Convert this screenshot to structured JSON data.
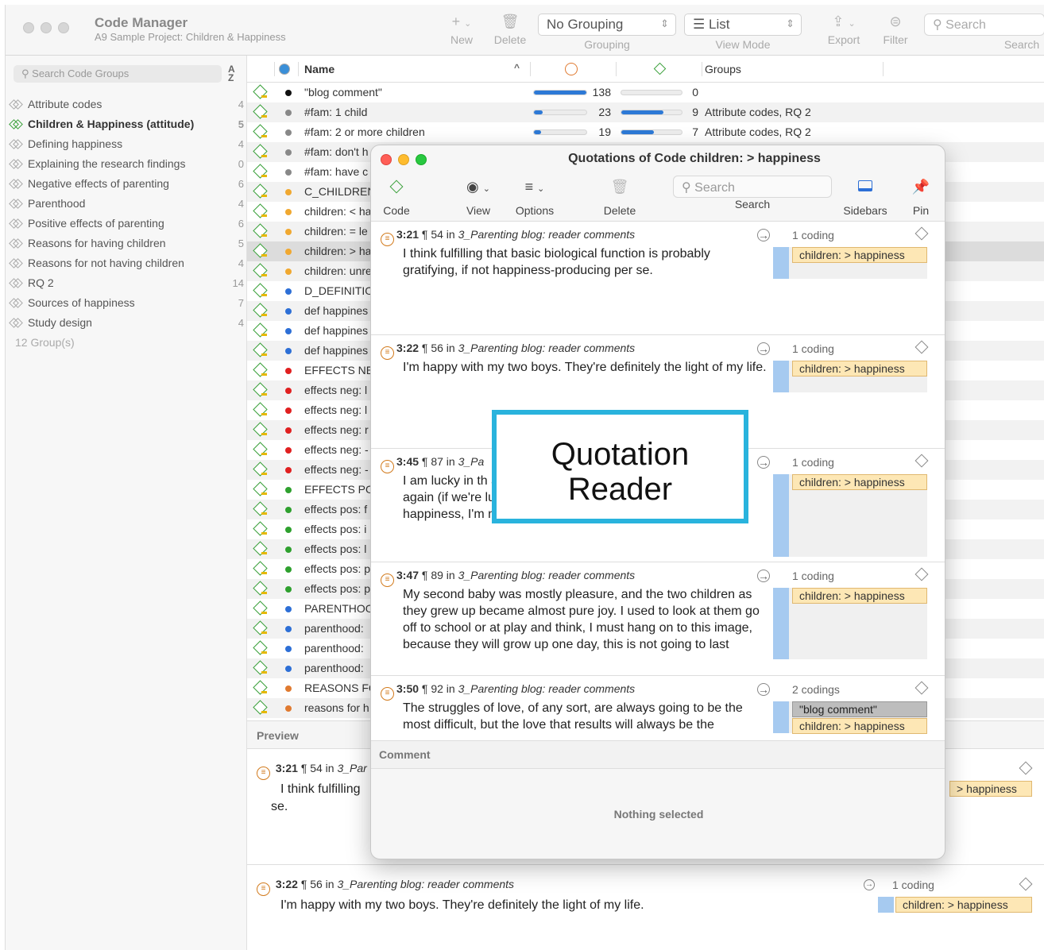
{
  "window": {
    "title": "Code Manager",
    "subtitle": "A9 Sample Project: Children & Happiness"
  },
  "toolbar": {
    "new_label": "New",
    "delete_label": "Delete",
    "grouping_value": "No Grouping",
    "grouping_label": "Grouping",
    "viewmode_value": "List",
    "viewmode_label": "View Mode",
    "export_label": "Export",
    "filter_label": "Filter",
    "search_placeholder": "Search",
    "search_label": "Search"
  },
  "sidebar": {
    "search_placeholder": "Search Code Groups",
    "groups": [
      {
        "label": "Attribute codes",
        "count": "4"
      },
      {
        "label": "Children & Happiness (attitude)",
        "count": "5"
      },
      {
        "label": "Defining happiness",
        "count": "4"
      },
      {
        "label": "Explaining the research findings",
        "count": "0"
      },
      {
        "label": "Negative effects of parenting",
        "count": "6"
      },
      {
        "label": "Parenthood",
        "count": "4"
      },
      {
        "label": "Positive effects of parenting",
        "count": "6"
      },
      {
        "label": "Reasons for having children",
        "count": "5"
      },
      {
        "label": "Reasons for not having children",
        "count": "4"
      },
      {
        "label": "RQ 2",
        "count": "14"
      },
      {
        "label": "Sources of happiness",
        "count": "7"
      },
      {
        "label": "Study design",
        "count": "4"
      }
    ],
    "footer": "12 Group(s)"
  },
  "table": {
    "col_name": "Name",
    "col_groups": "Groups",
    "rows": [
      {
        "name": "\"blog comment\"",
        "color": "#111111",
        "q": "138",
        "qf": 1.0,
        "d": "0",
        "df": 0.0,
        "groups": ""
      },
      {
        "name": "#fam: 1 child",
        "color": "#888888",
        "q": "23",
        "qf": 0.17,
        "d": "9",
        "df": 0.7,
        "groups": "Attribute codes, RQ 2"
      },
      {
        "name": "#fam: 2 or more  children",
        "color": "#888888",
        "q": "19",
        "qf": 0.14,
        "d": "7",
        "df": 0.54,
        "groups": "Attribute codes, RQ 2"
      },
      {
        "name": "#fam: don't h",
        "color": "#888888"
      },
      {
        "name": "#fam: have c",
        "color": "#888888"
      },
      {
        "name": "C_CHILDREN",
        "color": "#f0a830"
      },
      {
        "name": "children: < ha",
        "color": "#f0a830"
      },
      {
        "name": "children: = le",
        "color": "#f0a830"
      },
      {
        "name": "children: > ha",
        "color": "#f0a830"
      },
      {
        "name": "children: unre",
        "color": "#f0a830"
      },
      {
        "name": "D_DEFINITIO",
        "color": "#2d6fd6"
      },
      {
        "name": "def happines",
        "color": "#2d6fd6"
      },
      {
        "name": "def happines",
        "color": "#2d6fd6"
      },
      {
        "name": "def happines",
        "color": "#2d6fd6"
      },
      {
        "name": "EFFECTS NE",
        "color": "#e02020"
      },
      {
        "name": "effects neg: l",
        "color": "#e02020"
      },
      {
        "name": "effects neg: l",
        "color": "#e02020"
      },
      {
        "name": "effects neg: r",
        "color": "#e02020"
      },
      {
        "name": "effects neg: -",
        "color": "#e02020"
      },
      {
        "name": "effects neg: -",
        "color": "#e02020"
      },
      {
        "name": "EFFECTS PO",
        "color": "#2ea02e"
      },
      {
        "name": "effects pos: f",
        "color": "#2ea02e"
      },
      {
        "name": "effects pos: i",
        "color": "#2ea02e"
      },
      {
        "name": "effects pos: l",
        "color": "#2ea02e"
      },
      {
        "name": "effects pos: p",
        "color": "#2ea02e"
      },
      {
        "name": "effects pos: p",
        "color": "#2ea02e"
      },
      {
        "name": "PARENTHOO",
        "color": "#2d6fd6"
      },
      {
        "name": "parenthood:",
        "color": "#2d6fd6"
      },
      {
        "name": "parenthood:",
        "color": "#2d6fd6"
      },
      {
        "name": "parenthood:",
        "color": "#2d6fd6"
      },
      {
        "name": "REASONS FC",
        "color": "#e07a30"
      },
      {
        "name": "reasons for h",
        "color": "#e07a30"
      }
    ]
  },
  "preview": {
    "header": "Preview",
    "items": [
      {
        "id": "3:21",
        "para": "¶ 54 in",
        "doc": "3_Par",
        "text_line1": "I think fulfilling",
        "text_line2": "se.",
        "tag": "> happiness"
      },
      {
        "id": "3:22",
        "para": "¶ 56 in",
        "doc": "3_Parenting blog: reader comments",
        "text_line1": "I'm happy with my two boys. They're definitely the light of my life.",
        "count": "1 coding",
        "tag": "children: > happiness"
      }
    ]
  },
  "reader": {
    "title": "Quotations of Code children: > happiness",
    "tb": {
      "code": "Code",
      "view": "View",
      "options": "Options",
      "delete": "Delete",
      "search_placeholder": "Search",
      "search": "Search",
      "sidebars": "Sidebars",
      "pin": "Pin"
    },
    "quotes": [
      {
        "id": "3:21",
        "para": "¶ 54 in",
        "doc": "3_Parenting blog: reader comments",
        "count": "1 coding",
        "text": "I think fulfilling that basic biological function is probably gratifying, if not happiness-producing per se.",
        "tags": [
          "children: > happiness"
        ]
      },
      {
        "id": "3:22",
        "para": "¶ 56 in",
        "doc": "3_Parenting blog: reader comments",
        "count": "1 coding",
        "text": "I'm happy with my two boys. They're definitely the light of my life.",
        "tags": [
          "children: > happiness"
        ]
      },
      {
        "id": "3:45",
        "para": "¶ 87 in",
        "doc": "3_Pa",
        "count": "1 coding",
        "text": "I am lucky in th and motherhoc challenge that certainly do it again (if we're lucky enough to have another one). If this isn't happiness, I'm not sure what is.",
        "tags": [
          "children: > happiness"
        ]
      },
      {
        "id": "3:47",
        "para": "¶ 89 in",
        "doc": "3_Parenting blog: reader comments",
        "count": "1 coding",
        "text": " My second baby was mostly pleasure, and the two children as they grew up became almost pure joy. I used to look at them go off to school or at play and think, I must hang on to this image, because they will grow up one day, this is not going to last",
        "tags": [
          "children: > happiness"
        ]
      },
      {
        "id": "3:50",
        "para": "¶ 92 in",
        "doc": "3_Parenting blog: reader comments",
        "count": "2 codings",
        "text": " The struggles of love, of any sort, are always going to be the most difficult, but the love that results will always be the",
        "tags": [
          "\"blog comment\"",
          "children: > happiness"
        ]
      }
    ],
    "comment_header": "Comment",
    "nothing_selected": "Nothing selected"
  },
  "callout": {
    "line1": "Quotation",
    "line2": "Reader"
  }
}
